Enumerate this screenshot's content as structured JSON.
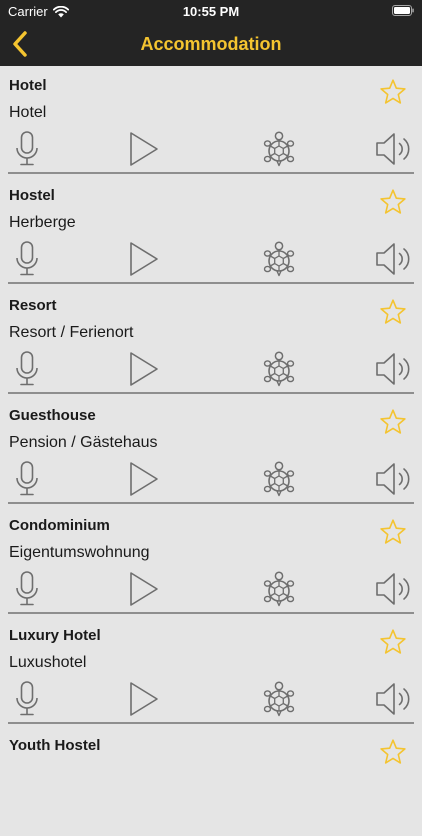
{
  "status": {
    "carrier": "Carrier",
    "time": "10:55 PM"
  },
  "nav": {
    "title": "Accommodation",
    "back_icon": "chevron-left-icon"
  },
  "colors": {
    "bar_background": "#242424",
    "accent": "#f4c430",
    "list_background": "#e5e5e5",
    "divider": "#8e8e8e",
    "icon_gray": "#6e6e6e"
  },
  "entries": [
    {
      "term": "Hotel",
      "translation": "Hotel"
    },
    {
      "term": "Hostel",
      "translation": "Herberge"
    },
    {
      "term": "Resort",
      "translation": "Resort / Ferienort"
    },
    {
      "term": "Guesthouse",
      "translation": "Pension / Gästehaus"
    },
    {
      "term": "Condominium",
      "translation": "Eigentumswohnung"
    },
    {
      "term": "Luxury Hotel",
      "translation": "Luxushotel"
    },
    {
      "term": "Youth Hostel",
      "translation": ""
    }
  ]
}
